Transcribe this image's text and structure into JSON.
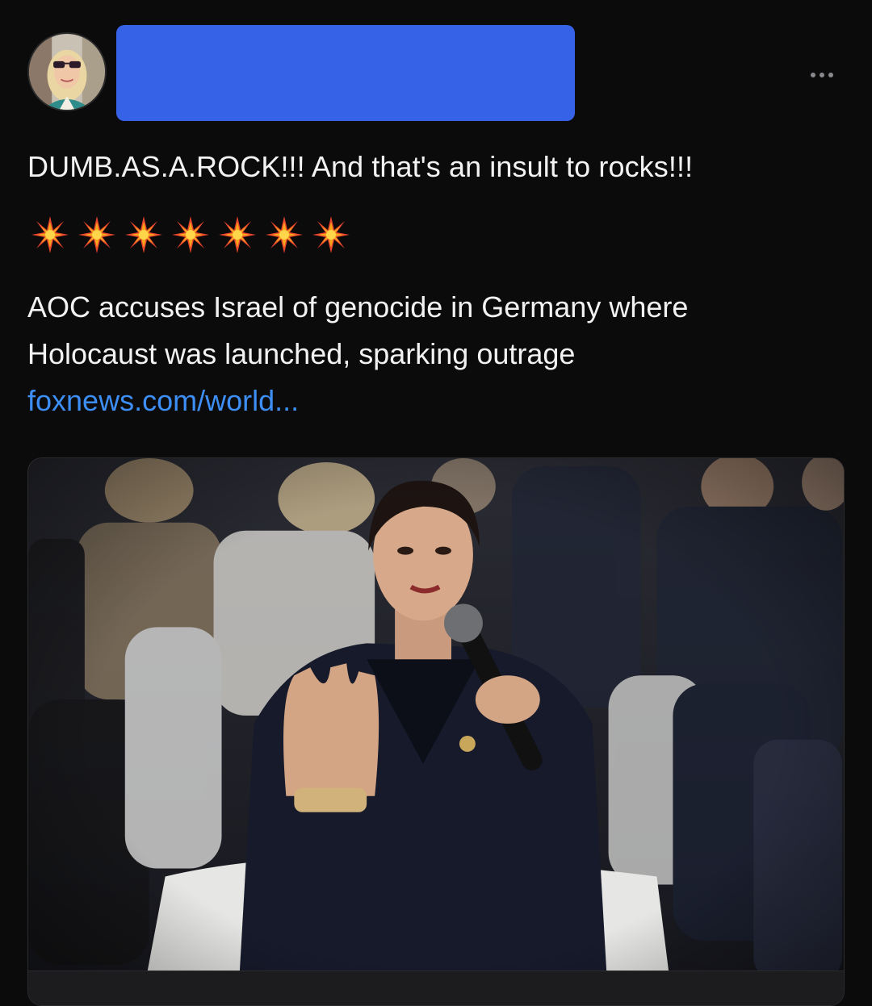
{
  "post": {
    "text_line1": "DUMB.AS.A.ROCK!!! And that's an insult to rocks!!!",
    "emoji_row": {
      "icon": "eight-pointed-star",
      "count": 7
    },
    "headline_text": "AOC accuses Israel of genocide in Germany where Holocaust was launched, sparking outrage",
    "link_text": "foxnews.com/world...",
    "link_color": "#3d8ef5",
    "redaction_color": "#3562e6"
  }
}
